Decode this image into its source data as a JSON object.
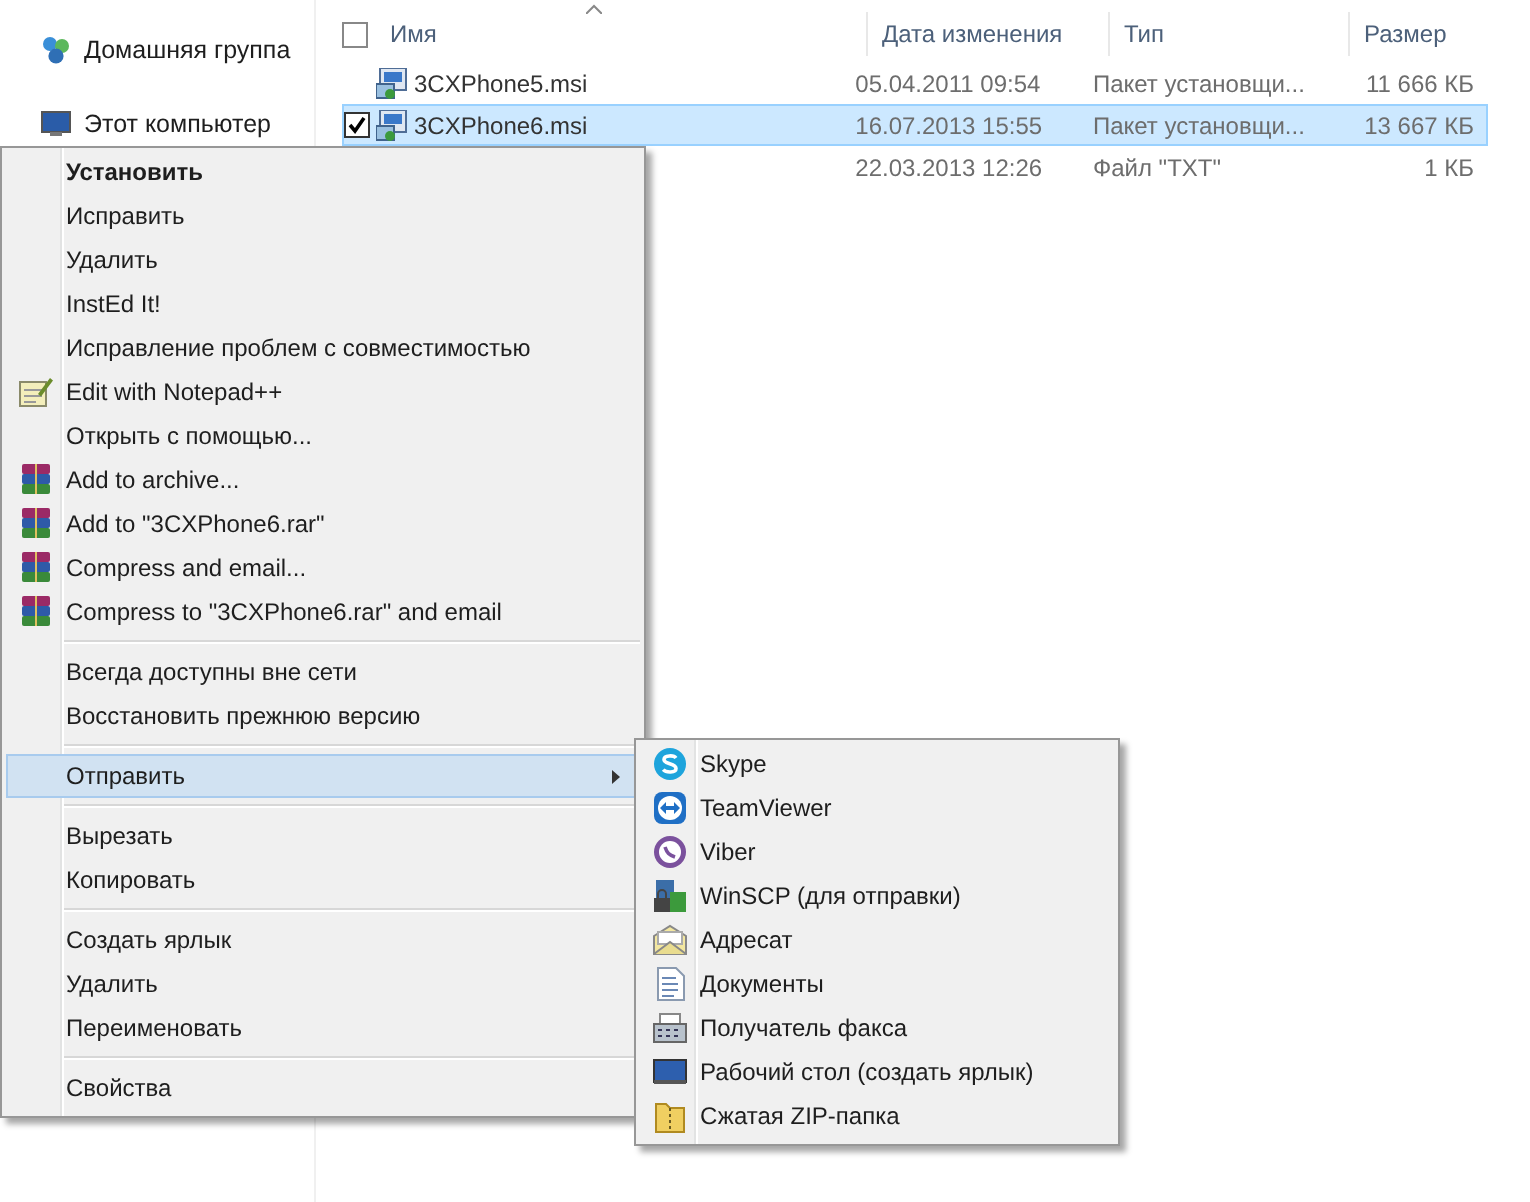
{
  "navigation": {
    "items": [
      {
        "label": "Домашняя группа"
      },
      {
        "label": "Этот компьютер"
      }
    ]
  },
  "file_list": {
    "select_all": {
      "checked": false
    },
    "columns": [
      "Имя",
      "Дата изменения",
      "Тип",
      "Размер"
    ],
    "rows": [
      {
        "name": "3CXPhone5.msi",
        "modified": "05.04.2011 09:54",
        "type": "Пакет установщи...",
        "size": "11 666 КБ",
        "selected": false,
        "checked": false
      },
      {
        "name": "3CXPhone6.msi",
        "modified": "16.07.2013 15:55",
        "type": "Пакет установщи...",
        "size": "13 667 КБ",
        "selected": true,
        "checked": true
      },
      {
        "modified": "22.03.2013 12:26",
        "type": "Файл \"TXT\"",
        "size": "1 КБ",
        "selected": false,
        "checked": false
      }
    ]
  },
  "context_menu": {
    "items": [
      {
        "kind": "default",
        "label": "Установить",
        "selected": false
      },
      {
        "kind": "item",
        "label": "Исправить",
        "selected": false
      },
      {
        "kind": "item",
        "label": "Удалить",
        "selected": false
      },
      {
        "kind": "item",
        "label": "InstEd It!",
        "selected": false
      },
      {
        "kind": "item",
        "label": "Исправление проблем с совместимостью",
        "selected": false
      },
      {
        "kind": "item",
        "label": "Edit with Notepad++",
        "selected": false
      },
      {
        "kind": "item",
        "label": "Открыть с помощью...",
        "selected": false
      },
      {
        "kind": "item",
        "label": "Add to archive...",
        "selected": false
      },
      {
        "kind": "item",
        "label": "Add to \"3CXPhone6.rar\"",
        "selected": false
      },
      {
        "kind": "item",
        "label": "Compress and email...",
        "selected": false
      },
      {
        "kind": "item",
        "label": "Compress to \"3CXPhone6.rar\" and email",
        "selected": false
      },
      {
        "kind": "separator"
      },
      {
        "kind": "item",
        "label": "Всегда доступны вне сети",
        "selected": false
      },
      {
        "kind": "item",
        "label": "Восстановить прежнюю версию",
        "selected": false
      },
      {
        "kind": "separator"
      },
      {
        "kind": "submenu",
        "label": "Отправить",
        "selected": true
      },
      {
        "kind": "separator"
      },
      {
        "kind": "item",
        "label": "Вырезать",
        "selected": false
      },
      {
        "kind": "item",
        "label": "Копировать",
        "selected": false
      },
      {
        "kind": "separator"
      },
      {
        "kind": "item",
        "label": "Создать ярлык",
        "selected": false
      },
      {
        "kind": "item",
        "label": "Удалить",
        "selected": false
      },
      {
        "kind": "item",
        "label": "Переименовать",
        "selected": false
      },
      {
        "kind": "separator"
      },
      {
        "kind": "item",
        "label": "Свойства",
        "selected": false
      }
    ]
  },
  "send_to_menu": {
    "items": [
      {
        "kind": "item",
        "label": "Skype",
        "selected": false
      },
      {
        "kind": "item",
        "label": "TeamViewer",
        "selected": false
      },
      {
        "kind": "item",
        "label": "Viber",
        "selected": false
      },
      {
        "kind": "item",
        "label": "WinSCP (для отправки)",
        "selected": false
      },
      {
        "kind": "item",
        "label": "Адресат",
        "selected": false
      },
      {
        "kind": "item",
        "label": "Документы",
        "selected": false
      },
      {
        "kind": "item",
        "label": "Получатель факса",
        "selected": false
      },
      {
        "kind": "item",
        "label": "Рабочий стол (создать ярлык)",
        "selected": false
      },
      {
        "kind": "item",
        "label": "Сжатая ZIP-папка",
        "selected": false
      }
    ]
  }
}
